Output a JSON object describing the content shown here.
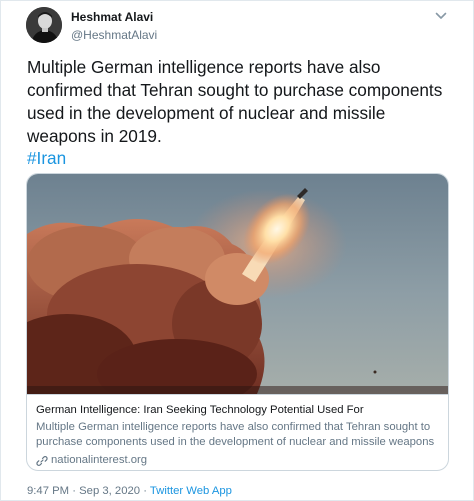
{
  "author": {
    "display_name": "Heshmat Alavi",
    "handle": "@HeshmatAlavi"
  },
  "tweet": {
    "text": "Multiple German intelligence reports have also confirmed that Tehran sought to purchase components used in the development of nuclear and missile weapons in 2019.",
    "hashtag": "#Iran"
  },
  "card": {
    "title": "German Intelligence: Iran Seeking Technology Potential Used For",
    "description": "Multiple German intelligence reports have also confirmed that Tehran sought to purchase components used in the development of nuclear and missile weapons i...",
    "domain": "nationalinterest.org"
  },
  "meta": {
    "time": "9:47 PM",
    "separator": "·",
    "date": "Sep 3, 2020",
    "app": "Twitter Web App"
  },
  "icons": {
    "menu": "chevron-down-icon",
    "link": "link-icon"
  },
  "colors": {
    "link_blue": "#1b95e0",
    "secondary_text": "#657786",
    "border": "#ccd6dd"
  }
}
